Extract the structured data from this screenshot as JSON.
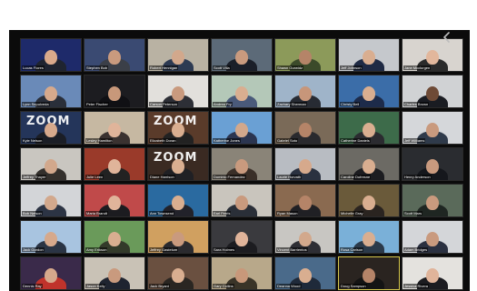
{
  "meeting": {
    "name": "zoom-gallery-view",
    "rows": 7,
    "columns": 7
  },
  "overlay": {
    "icon": "chevron-left-icon"
  },
  "participants": [
    {
      "name": "Lucas Flores",
      "bg": "#1e2a6a",
      "skin": "#d9a98b",
      "shirt": "#1f2430"
    },
    {
      "name": "Stephen Bob",
      "bg": "#3a4a72",
      "skin": "#c99a7e",
      "shirt": "#3b3f48"
    },
    {
      "name": "Robert Hennigan",
      "bg": "#b9b2a3",
      "skin": "#d2a88c",
      "shirt": "#2d3a52"
    },
    {
      "name": "Scott Villa",
      "bg": "#5c6a78",
      "skin": "#c99a7e",
      "shirt": "#1b1f29"
    },
    {
      "name": "Shawn Gurwidz",
      "bg": "#8c9a5a",
      "skin": "#b58468",
      "shirt": "#3b4a2a"
    },
    {
      "name": "Jeff Johnson",
      "bg": "#c5c8cc",
      "skin": "#d9ae90",
      "shirt": "#1f2a44"
    },
    {
      "name": "Jane Mcclurgen",
      "bg": "#d8d4cf",
      "skin": "#e2b79c",
      "shirt": "#2b2b2b"
    },
    {
      "name": "Lynn Sepulveda",
      "bg": "#6a8ab8",
      "skin": "#d6a98c",
      "shirt": "#2a2f3a"
    },
    {
      "name": "Peter Fischer",
      "bg": "#1c1c20",
      "skin": "#c8987a",
      "shirt": "#101014"
    },
    {
      "name": "Carson Peterson",
      "bg": "#e2e0dc",
      "skin": "#c99a7e",
      "shirt": "#2d2f36"
    },
    {
      "name": "Andrea Fry",
      "bg": "#b4c8b8",
      "skin": "#d9ae90",
      "shirt": "#4a5a7a"
    },
    {
      "name": "Zachary Sherman",
      "bg": "#9fb4c9",
      "skin": "#c7967a",
      "shirt": "#272b33"
    },
    {
      "name": "Christy Bell",
      "bg": "#3b6da8",
      "skin": "#d9ae90",
      "shirt": "#1d2b4a"
    },
    {
      "name": "Charles Brown",
      "bg": "#d0d2d4",
      "skin": "#6e4a36",
      "shirt": "#1a1c22"
    },
    {
      "name": "Kyle Nelson",
      "bg": "#24355a",
      "skin": "#d6a98c",
      "shirt": "#1b1e26",
      "zoom": "ZOOM"
    },
    {
      "name": "Lesley Hamilton",
      "bg": "#c6b8a2",
      "skin": "#e0b49a",
      "shirt": "#3a3230"
    },
    {
      "name": "Elizabeth Doran",
      "bg": "#5a3b2a",
      "skin": "#d9ae90",
      "shirt": "#222",
      "zoom": "ZOOM"
    },
    {
      "name": "Katherine Jones",
      "bg": "#6aa0d4",
      "skin": "#d2a88c",
      "shirt": "#2b3550"
    },
    {
      "name": "Gabriel Soto",
      "bg": "#7a6a58",
      "skin": "#b58468",
      "shirt": "#2a2a2e"
    },
    {
      "name": "Catherine Daniels",
      "bg": "#3d6b4a",
      "skin": "#d9ae90",
      "shirt": "#2b2b30"
    },
    {
      "name": "Jeff Williams",
      "bg": "#d5d7da",
      "skin": "#c99a7e",
      "shirt": "#2f3a4a"
    },
    {
      "name": "Jeffrey Thayer",
      "bg": "#c9c6c0",
      "skin": "#d2a88c",
      "shirt": "#34302c"
    },
    {
      "name": "Julie Leen",
      "bg": "#9a3a2a",
      "skin": "#e0b49a",
      "shirt": "#222"
    },
    {
      "name": "Diane Harrison",
      "bg": "#3a2a22",
      "skin": "#d9ae90",
      "shirt": "#202024",
      "zoom": "ZOOM"
    },
    {
      "name": "Dominic Fernandez",
      "bg": "#8a8478",
      "skin": "#c99a7e",
      "shirt": "#3a2f28"
    },
    {
      "name": "Laurie Horvath",
      "bg": "#b8bcc2",
      "skin": "#d6a98c",
      "shirt": "#2a3140"
    },
    {
      "name": "Caroline Dufresne",
      "bg": "#6c6a64",
      "skin": "#d9ae90",
      "shirt": "#1c1c20"
    },
    {
      "name": "Henry Anderson",
      "bg": "#2a2c30",
      "skin": "#c99a7e",
      "shirt": "#15171c"
    },
    {
      "name": "Bob Nelson",
      "bg": "#d3d5d8",
      "skin": "#d2a88c",
      "shirt": "#2c3444"
    },
    {
      "name": "Maria Brandt",
      "bg": "#c04a4a",
      "skin": "#e0b49a",
      "shirt": "#1c1c20"
    },
    {
      "name": "Ann Townsend",
      "bg": "#2a6aa0",
      "skin": "#d9ae90",
      "shirt": "#22222a"
    },
    {
      "name": "Earl Ferris",
      "bg": "#c9c5bd",
      "skin": "#c99a7e",
      "shirt": "#2a2f38"
    },
    {
      "name": "Ryan Mason",
      "bg": "#8a6a50",
      "skin": "#b58468",
      "shirt": "#202024"
    },
    {
      "name": "Michelle Gray",
      "bg": "#6a5a3a",
      "skin": "#d9ae90",
      "shirt": "#2a2420"
    },
    {
      "name": "Scott Mars",
      "bg": "#5a6a5a",
      "skin": "#c99a7e",
      "shirt": "#1f2622"
    },
    {
      "name": "Jack Gordon",
      "bg": "#a8c4e0",
      "skin": "#d6a98c",
      "shirt": "#2a3444"
    },
    {
      "name": "Amy Erikson",
      "bg": "#6a9a5a",
      "skin": "#d9ae90",
      "shirt": "#333a2a"
    },
    {
      "name": "Jeffrey Gastelum",
      "bg": "#d0a060",
      "skin": "#c99a7e",
      "shirt": "#2a2a2e"
    },
    {
      "name": "Sara Holmes",
      "bg": "#3a3a3e",
      "skin": "#e0b49a",
      "shirt": "#1c1c20"
    },
    {
      "name": "Vincent Barrientos",
      "bg": "#c8c6c2",
      "skin": "#d2a88c",
      "shirt": "#2e2e34"
    },
    {
      "name": "Rosa Carlson",
      "bg": "#7ab0d8",
      "skin": "#d9ae90",
      "shirt": "#2b3a4a"
    },
    {
      "name": "Adam Bridges",
      "bg": "#d4d6d9",
      "skin": "#c99a7e",
      "shirt": "#2a3040"
    },
    {
      "name": "Dennis Ray",
      "bg": "#3a2a4a",
      "skin": "#d6a98c",
      "shirt": "#c0332b"
    },
    {
      "name": "Jason Kelly",
      "bg": "#c9c2b6",
      "skin": "#c99a7e",
      "shirt": "#1f2430"
    },
    {
      "name": "Jack Bryant",
      "bg": "#6a5040",
      "skin": "#d9ae90",
      "shirt": "#2a2622"
    },
    {
      "name": "Gary Collins",
      "bg": "#b8a88a",
      "skin": "#c8987a",
      "shirt": "#3a3428"
    },
    {
      "name": "Deanna Wood",
      "bg": "#4a6a8a",
      "skin": "#d9ae90",
      "shirt": "#1f2a3a"
    },
    {
      "name": "Doug Sampson",
      "bg": "#2a2420",
      "skin": "#b58468",
      "shirt": "#141414",
      "speaking": true
    },
    {
      "name": "Jessica Rivera",
      "bg": "#e4e2de",
      "skin": "#e0b49a",
      "shirt": "#1c1c20"
    }
  ]
}
